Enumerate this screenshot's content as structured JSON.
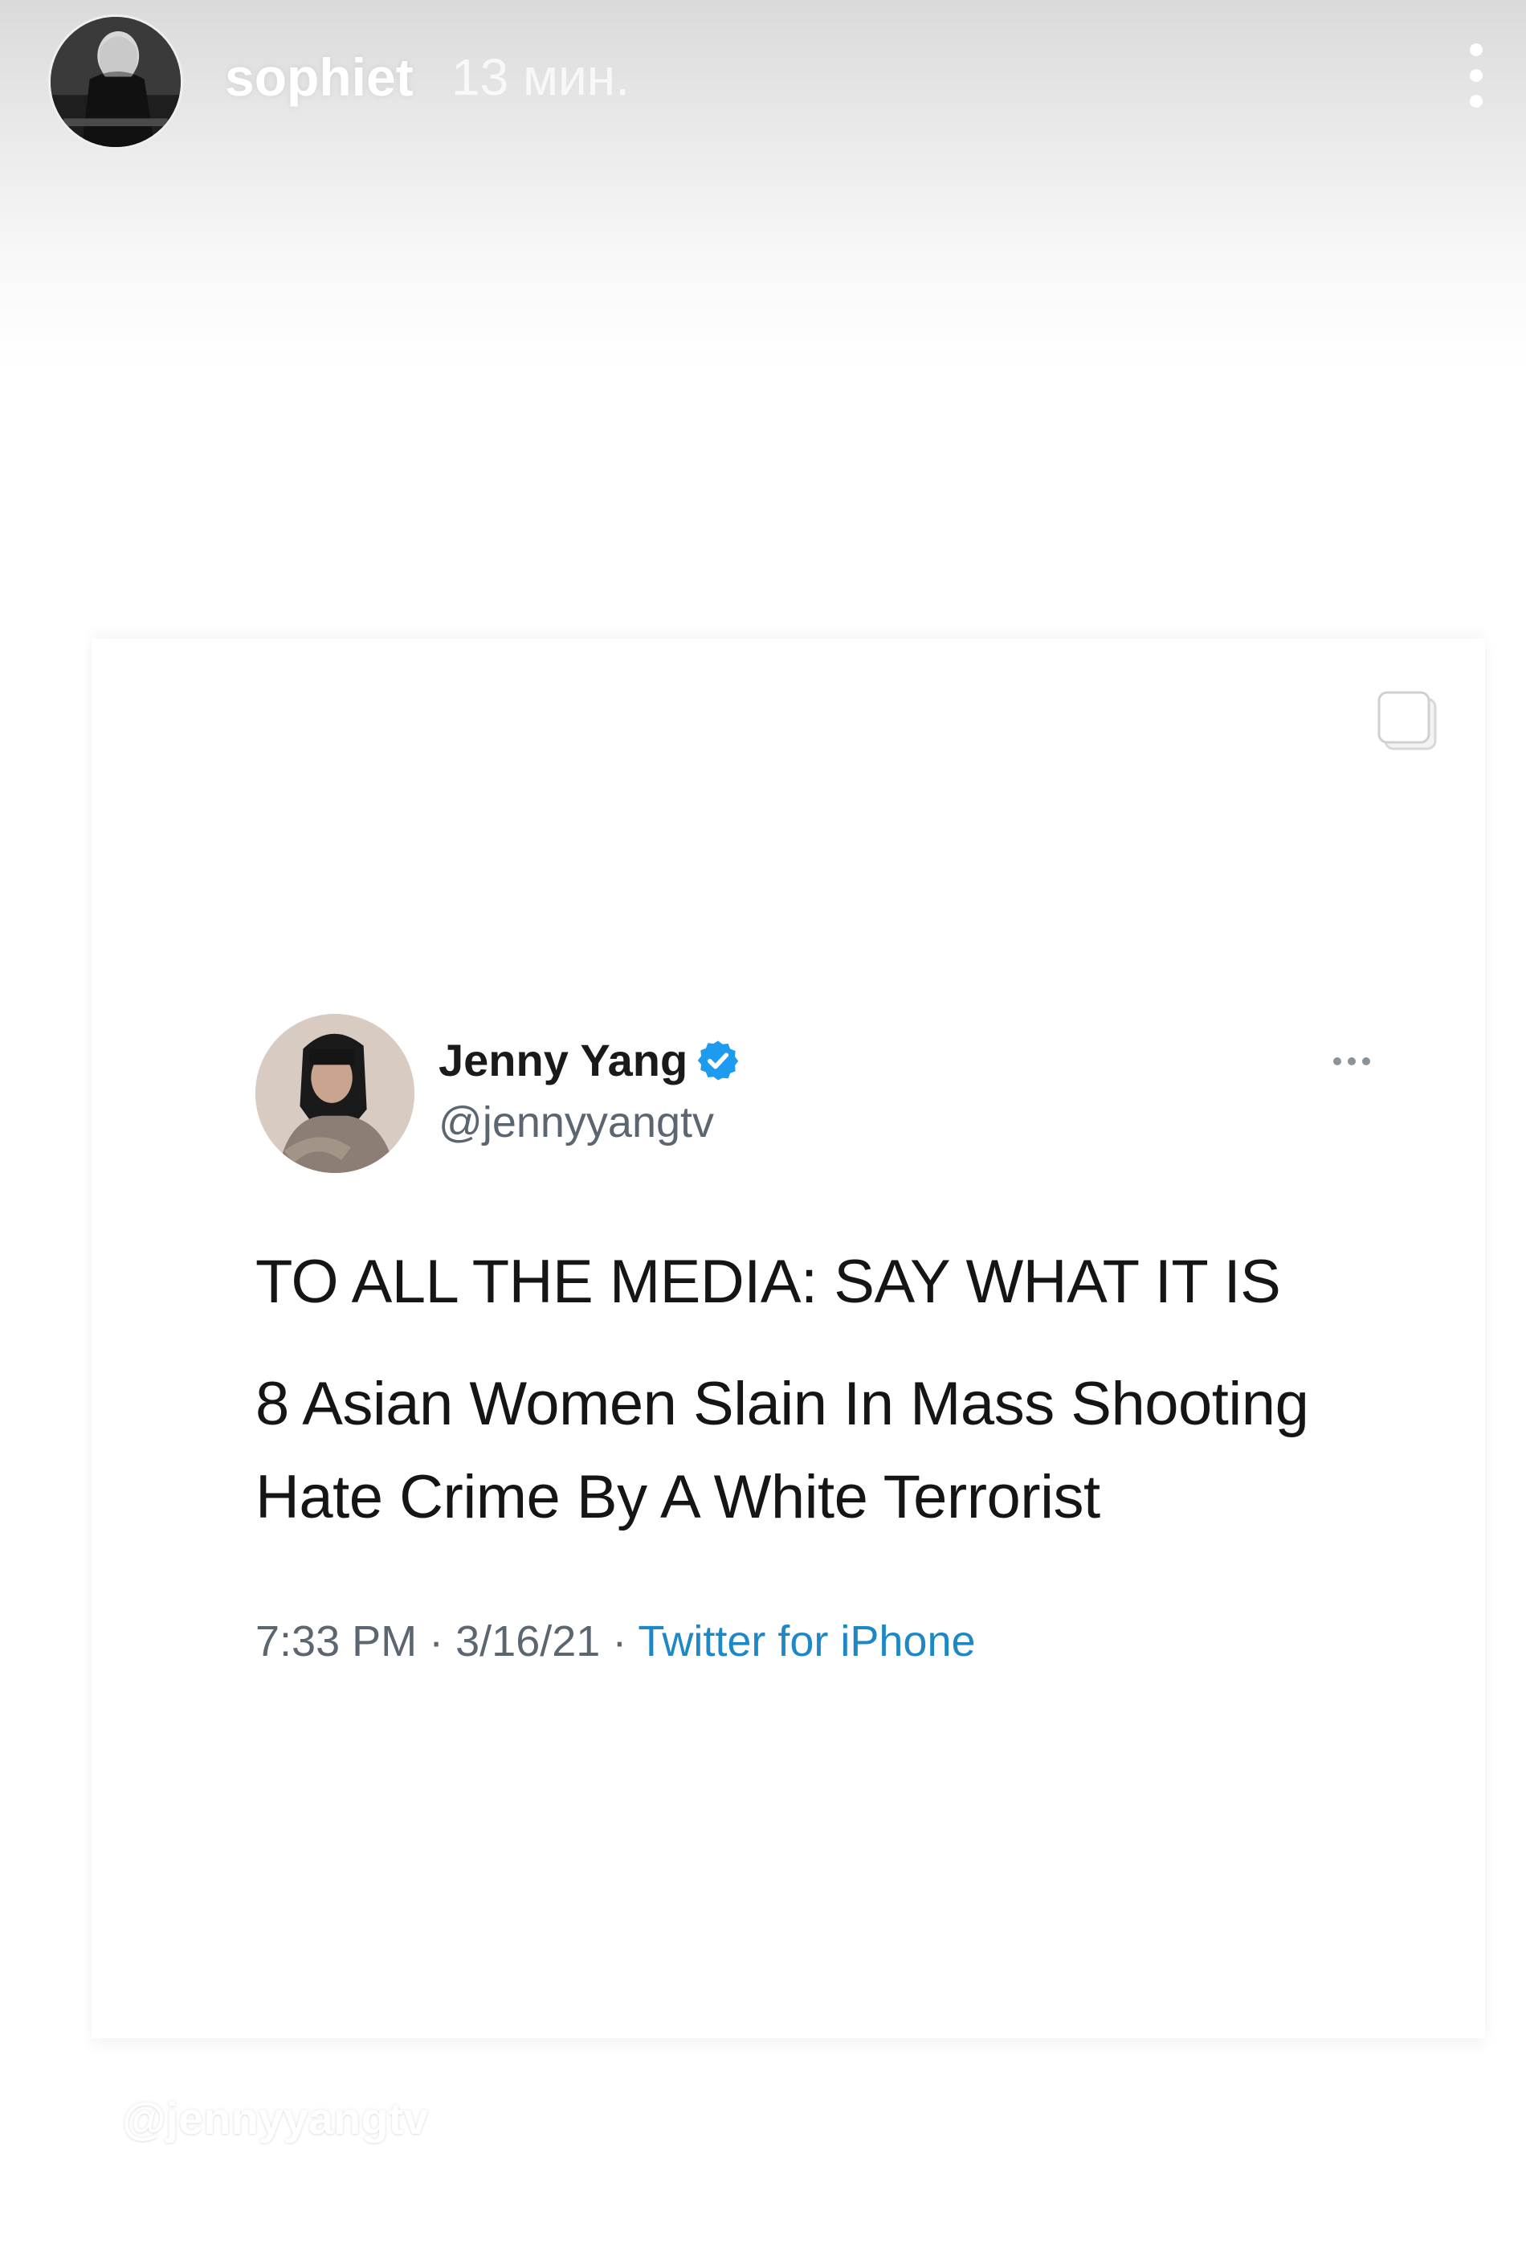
{
  "story": {
    "username": "sophiet",
    "time_ago": "13 мин.",
    "more_icon": "more-vertical-icon"
  },
  "tweet": {
    "display_name": "Jenny Yang",
    "verified_icon": "verified-badge-icon",
    "verified_color": "#1d9bf0",
    "handle": "@jennyyangtv",
    "more_icon": "more-horizontal-icon",
    "lines": [
      "TO ALL THE MEDIA: SAY WHAT IT IS",
      "8 Asian Women Slain In Mass Shooting",
      "Hate Crime By A White Terrorist"
    ],
    "time": "7:33 PM",
    "separator": "·",
    "date": "3/16/21",
    "source": "Twitter for iPhone",
    "source_color": "#1e88c7"
  },
  "card": {
    "copy_icon": "copy-icon"
  },
  "watermark": {
    "text": "@jennyyangtv"
  }
}
